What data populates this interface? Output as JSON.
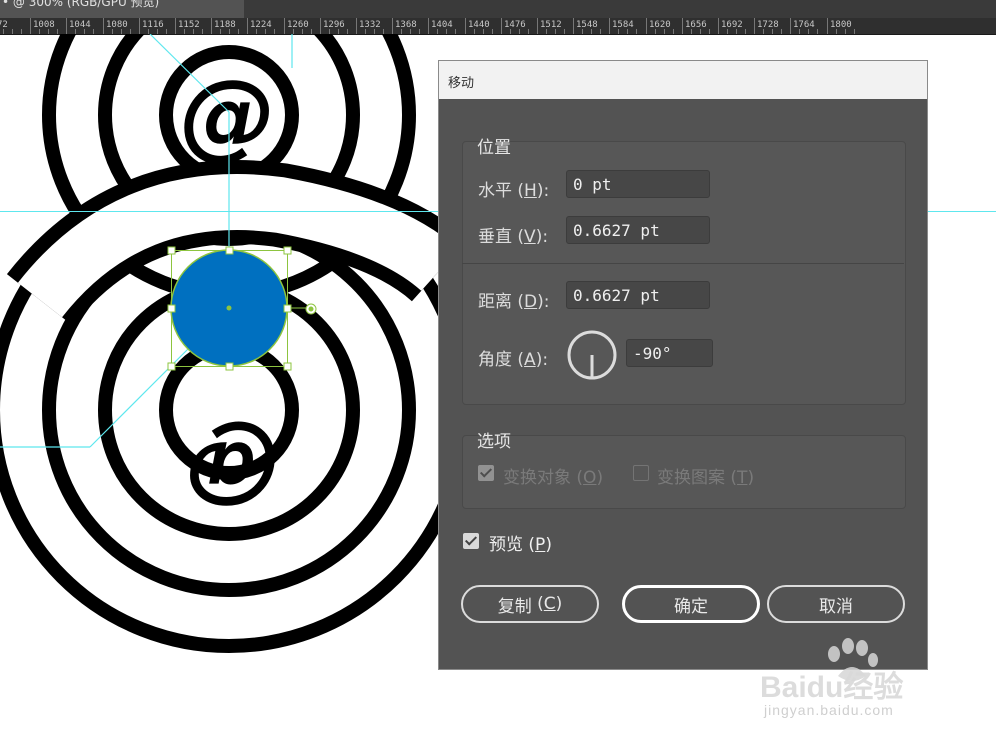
{
  "app": {
    "tab_title": "• @ 300% (RGB/GPU 预览)",
    "ruler_labels": [
      "72",
      "1008",
      "1044",
      "1080",
      "1116",
      "1152",
      "1188",
      "1224",
      "1260",
      "1296",
      "1332",
      "1368",
      "1404",
      "1440",
      "1476",
      "1512",
      "1548",
      "1584",
      "1620",
      "1656",
      "1692",
      "1728",
      "1764",
      "1800"
    ]
  },
  "artwork": {
    "top_glyph": "@",
    "bottom_glyph": "@",
    "circle_fill": "#0070c0",
    "selection_color": "#8dc43f",
    "guide_color": "#5ee7ee"
  },
  "dialog": {
    "title": "移动",
    "position_group": {
      "label": "位置",
      "horizontal": {
        "label": "水平",
        "key": "H",
        "value": "0 pt"
      },
      "vertical": {
        "label": "垂直",
        "key": "V",
        "value": "0.6627 pt"
      },
      "distance": {
        "label": "距离",
        "key": "D",
        "value": "0.6627 pt"
      },
      "angle": {
        "label": "角度",
        "key": "A",
        "value": "-90°"
      }
    },
    "options_group": {
      "label": "选项",
      "transform_objects": {
        "label": "变换对象",
        "key": "O",
        "checked": true,
        "enabled": false
      },
      "transform_patterns": {
        "label": "变换图案",
        "key": "T",
        "checked": false,
        "enabled": false
      }
    },
    "preview": {
      "label": "预览",
      "key": "P",
      "checked": true
    },
    "buttons": {
      "copy": {
        "label": "复制",
        "key": "C"
      },
      "ok": {
        "label": "确定"
      },
      "cancel": {
        "label": "取消"
      }
    }
  },
  "watermark": {
    "text": "Baidu经验",
    "url_text": "jingyan.baidu.com"
  }
}
